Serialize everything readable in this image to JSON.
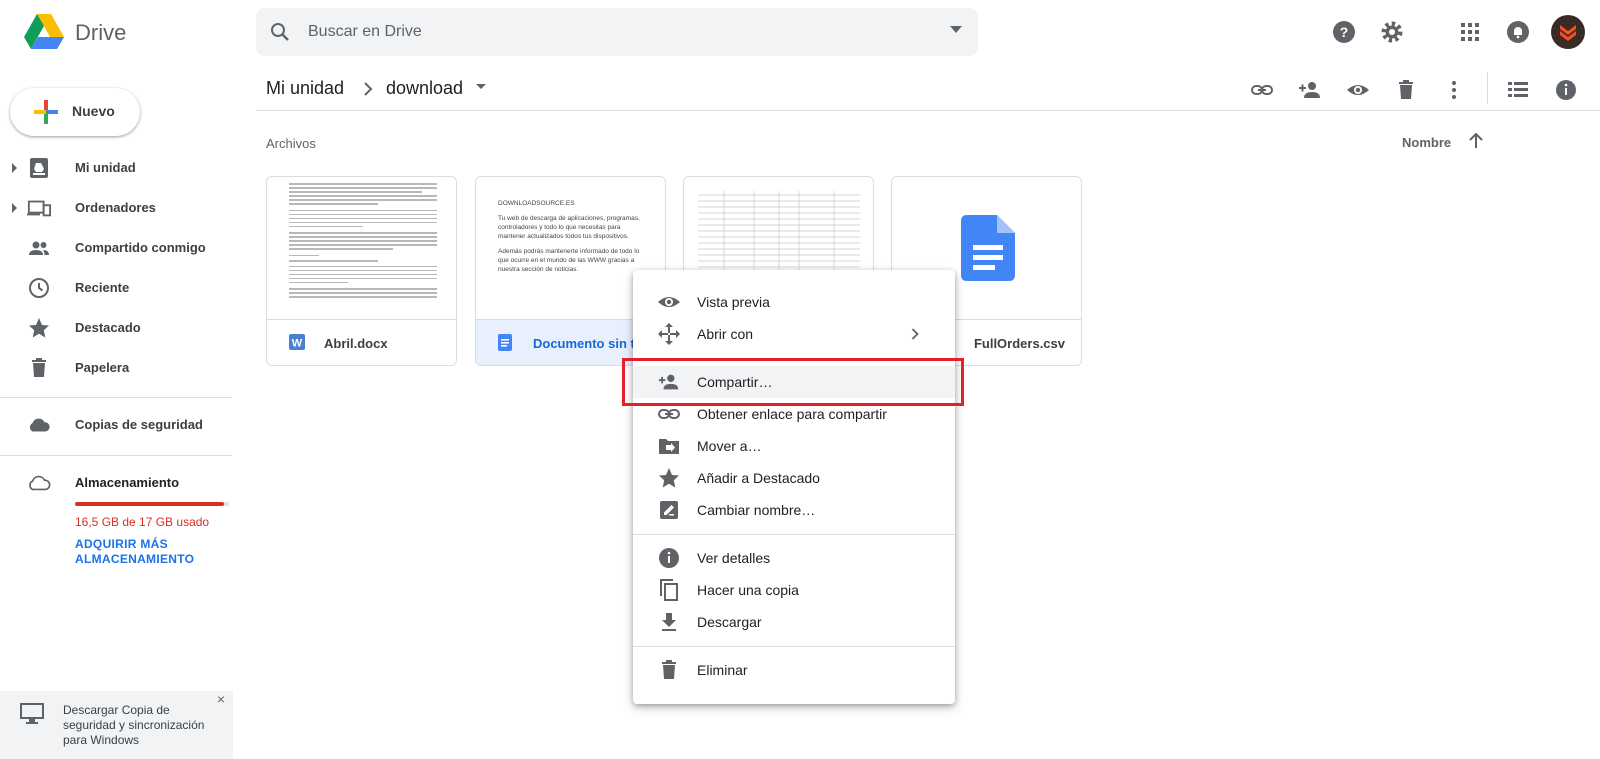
{
  "app": {
    "name": "Drive"
  },
  "search": {
    "placeholder": "Buscar en Drive"
  },
  "sidebar": {
    "new_label": "Nuevo",
    "items": [
      {
        "label": "Mi unidad",
        "icon": "drive-icon",
        "expandable": true
      },
      {
        "label": "Ordenadores",
        "icon": "computers-icon",
        "expandable": true
      },
      {
        "label": "Compartido conmigo",
        "icon": "shared-icon",
        "expandable": false
      },
      {
        "label": "Reciente",
        "icon": "clock-icon",
        "expandable": false
      },
      {
        "label": "Destacado",
        "icon": "star-icon",
        "expandable": false
      },
      {
        "label": "Papelera",
        "icon": "trash-icon",
        "expandable": false
      }
    ],
    "backup_label": "Copias de seguridad",
    "storage": {
      "label": "Almacenamiento",
      "used_text": "16,5 GB de 17 GB usado",
      "used_fraction": 0.97,
      "link_text": "ADQUIRIR MÁS ALMACENAMIENTO"
    },
    "promo": {
      "text": "Descargar Copia de seguridad y sincronización para Windows",
      "close": "×"
    }
  },
  "breadcrumb": {
    "root": "Mi unidad",
    "current": "download"
  },
  "files_section": {
    "title": "Archivos",
    "sort_label": "Nombre"
  },
  "files": [
    {
      "name": "Abril.docx",
      "type": "word"
    },
    {
      "name": "Documento sin título",
      "type": "docs",
      "selected": true,
      "preview": [
        "DOWNLOADSOURCE.ES",
        "Tu web de descarga de aplicaciones, programas, controladores y todo lo que necesitas para mantener actualizados todos tus dispositivos.",
        "Además podrás mantenerte informado de todo lo que ocurre en el mundo de las WWW gracias a nuestra sección de noticias."
      ]
    },
    {
      "name": "FullOrders.csv",
      "type": "sheet"
    },
    {
      "name": "FullOrders.csv",
      "type": "docs-big"
    }
  ],
  "context_menu": {
    "items": [
      {
        "label": "Vista previa",
        "icon": "eye-icon"
      },
      {
        "label": "Abrir con",
        "icon": "open-with-icon",
        "submenu": true
      },
      {
        "label": "Compartir…",
        "icon": "person-add-icon",
        "highlighted": true
      },
      {
        "label": "Obtener enlace para compartir",
        "icon": "link-icon"
      },
      {
        "label": "Mover a…",
        "icon": "move-folder-icon"
      },
      {
        "label": "Añadir a Destacado",
        "icon": "star-icon"
      },
      {
        "label": "Cambiar nombre…",
        "icon": "rename-icon"
      },
      {
        "label": "Ver detalles",
        "icon": "info-icon"
      },
      {
        "label": "Hacer una copia",
        "icon": "copy-icon"
      },
      {
        "label": "Descargar",
        "icon": "download-icon"
      },
      {
        "label": "Eliminar",
        "icon": "trash-icon"
      }
    ]
  },
  "colors": {
    "accent": "#1a73e8",
    "warning": "#d93025",
    "highlight_box": "#e3202c"
  }
}
